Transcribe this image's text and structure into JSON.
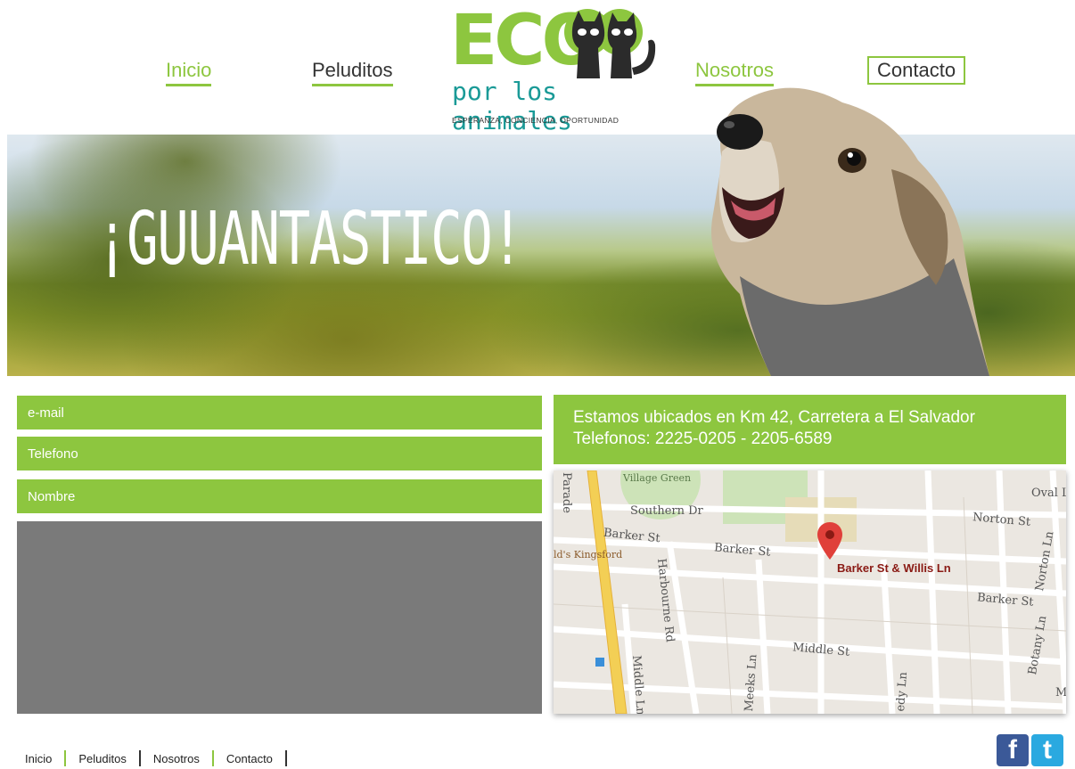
{
  "nav": {
    "inicio": "Inicio",
    "peluditos": "Peluditos",
    "nosotros": "Nosotros",
    "contacto": "Contacto"
  },
  "logo": {
    "brand": "ECO",
    "tagline": "por los animales",
    "slogan": "ESPERANZA, CONCIENCIA, OPORTUNIDAD"
  },
  "hero": {
    "headline": "¡GUUANTASTICO!"
  },
  "form": {
    "email_placeholder": "e-mail",
    "phone_placeholder": "Telefono",
    "name_placeholder": "Nombre"
  },
  "info": {
    "address": "Estamos ubicados en Km 42, Carretera a El Salvador",
    "phones": "Telefonos: 2225-0205 - 2205-6589"
  },
  "map": {
    "marker_label": "Barker St & Willis Ln",
    "labels": {
      "village_green": "Village Green",
      "southern_dr": "Southern Dr",
      "parade": "Parade",
      "barker_st_1": "Barker St",
      "barker_st_2": "Barker St",
      "barker_st_3": "Barker St",
      "kingsford": "ld's Kingsford",
      "harbourne": "Harbourne Rd",
      "middle_st": "Middle St",
      "middle_ln": "Middle Ln",
      "meeks": "Meeks Ln",
      "edy": "edy Ln",
      "botany": "Botany Ln",
      "norton_st": "Norton St",
      "norton_ln": "Norton Ln",
      "oval": "Oval L",
      "m": "M"
    }
  },
  "footer": {
    "inicio": "Inicio",
    "peluditos": "Peluditos",
    "nosotros": "Nosotros",
    "contacto": "Contacto"
  },
  "social": {
    "facebook": "f",
    "twitter": "t"
  },
  "colors": {
    "accent": "#8dc63f",
    "teal": "#1a9a97",
    "message_box": "#7a7a7a"
  }
}
